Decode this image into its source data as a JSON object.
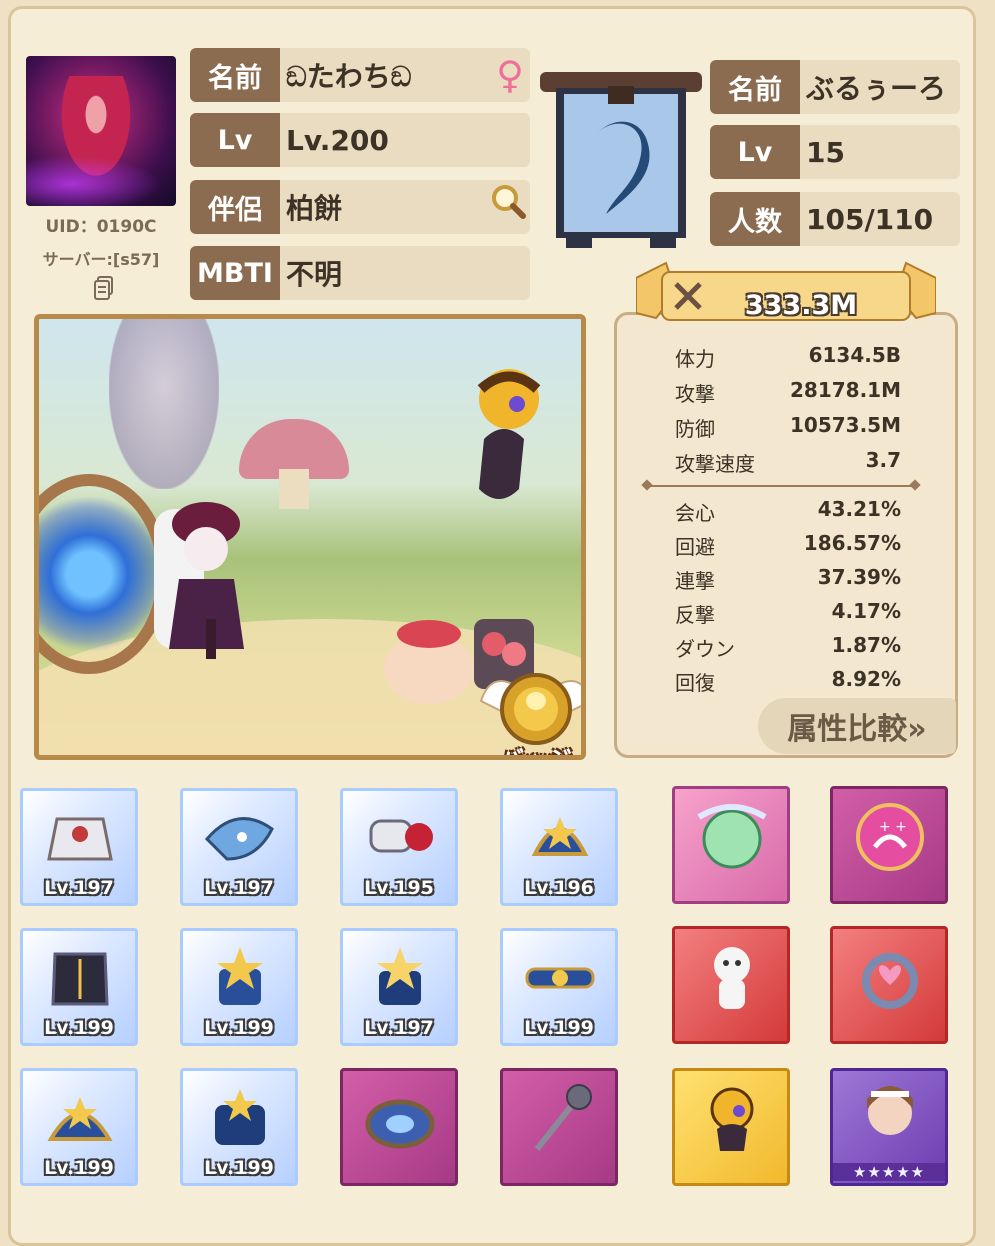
{
  "player": {
    "uid": "UID：0190C",
    "server": "サーバー:[s57]",
    "name_label": "名前",
    "name_value": "ඞたわちඞ",
    "lv_label": "Lv",
    "lv_value": "Lv.200",
    "partner_label": "伴侶",
    "partner_value": "柏餅",
    "mbti_label": "MBTI",
    "mbti_value": "不明",
    "gender_icon": "♀"
  },
  "guild": {
    "name_label": "名前",
    "name_value": "ぶるぅーろ",
    "lv_label": "Lv",
    "lv_value": "15",
    "members_label": "人数",
    "members_value": "105/110"
  },
  "power": "333.3M",
  "stats_basic": [
    {
      "k": "体力",
      "v": "6134.5B"
    },
    {
      "k": "攻撃",
      "v": "28178.1M"
    },
    {
      "k": "防御",
      "v": "10573.5M"
    },
    {
      "k": "攻撃速度",
      "v": "3.7"
    }
  ],
  "stats_extra": [
    {
      "k": "会心",
      "v": "43.21%"
    },
    {
      "k": "回避",
      "v": "186.57%"
    },
    {
      "k": "連撃",
      "v": "37.39%"
    },
    {
      "k": "反撃",
      "v": "4.17%"
    },
    {
      "k": "ダウン",
      "v": "1.87%"
    },
    {
      "k": "回復",
      "v": "8.92%"
    }
  ],
  "compare_button": "属性比較»",
  "badge_label": "バッジ",
  "equipment": [
    {
      "lv": "Lv.197"
    },
    {
      "lv": "Lv.197"
    },
    {
      "lv": "Lv.195"
    },
    {
      "lv": "Lv.196"
    },
    {
      "lv": "Lv.199"
    },
    {
      "lv": "Lv.199"
    },
    {
      "lv": "Lv.197"
    },
    {
      "lv": "Lv.199"
    },
    {
      "lv": "Lv.199"
    },
    {
      "lv": "Lv.199"
    }
  ],
  "stars": "★★★★★",
  "colors": {
    "label_bg": "#8b6c51",
    "value_bg": "#e9dcc0",
    "page_bg": "#f6edd6"
  }
}
